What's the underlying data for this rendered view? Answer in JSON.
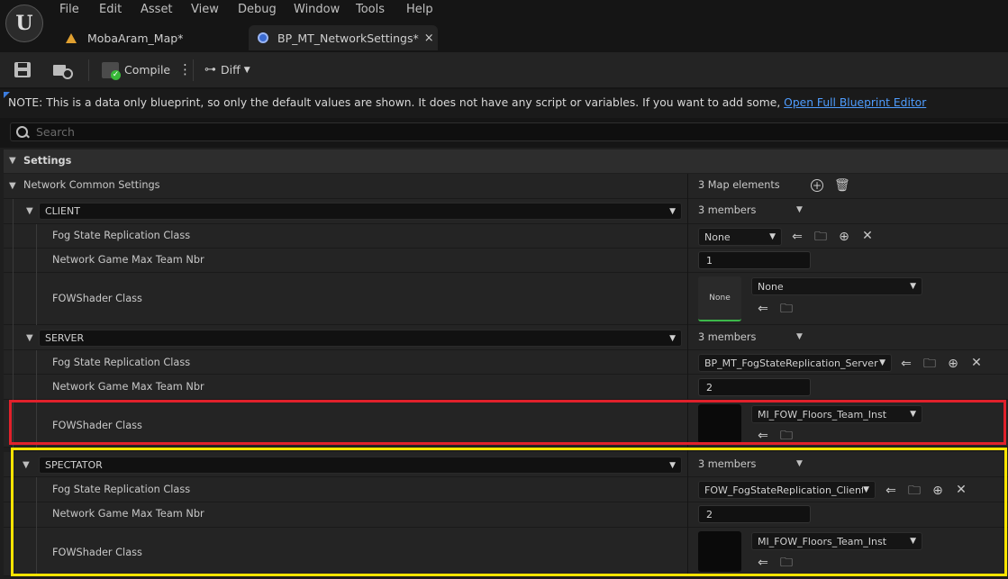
{
  "app": {
    "logo": "U",
    "menu": [
      "File",
      "Edit",
      "Asset",
      "View",
      "Debug",
      "Window",
      "Tools",
      "Help"
    ],
    "tabs": [
      {
        "label": "MobaAram_Map*",
        "icon": "map-icon"
      },
      {
        "label": "BP_MT_NetworkSettings*",
        "icon": "blueprint-icon",
        "close": "×"
      }
    ]
  },
  "toolbar": {
    "compile": "Compile",
    "diff": "Diff"
  },
  "note": {
    "text": "NOTE: This is a data only blueprint, so only the default values are shown.  It does not have any script or variables.  If you want to add some,",
    "link": "Open Full Blueprint Editor"
  },
  "search": {
    "placeholder": "Search"
  },
  "settings": {
    "category": "Settings",
    "map_label": "Network Common Settings",
    "map_count": "3 Map elements",
    "groups": [
      {
        "key": "CLIENT",
        "members": "3 members",
        "fog_label": "Fog State Replication Class",
        "fog_value": "None",
        "team_label": "Network Game Max Team Nbr",
        "team_value": "1",
        "shader_label": "FOWShader Class",
        "shader_thumb": "None",
        "shader_value": "None"
      },
      {
        "key": "SERVER",
        "members": "3 members",
        "fog_label": "Fog State Replication Class",
        "fog_value": "BP_MT_FogStateReplication_Server",
        "team_label": "Network Game Max Team Nbr",
        "team_value": "2",
        "shader_label": "FOWShader Class",
        "shader_value": "MI_FOW_Floors_Team_Inst"
      },
      {
        "key": "SPECTATOR",
        "members": "3 members",
        "fog_label": "Fog State Replication Class",
        "fog_value": "FOW_FogStateReplication_Client",
        "team_label": "Network Game Max Team Nbr",
        "team_value": "2",
        "shader_label": "FOWShader Class",
        "shader_value": "MI_FOW_Floors_Team_Inst"
      }
    ]
  },
  "colors": {
    "highlight_red": "#e1212b",
    "highlight_yellow": "#ffe400",
    "link": "#4f9dff"
  }
}
